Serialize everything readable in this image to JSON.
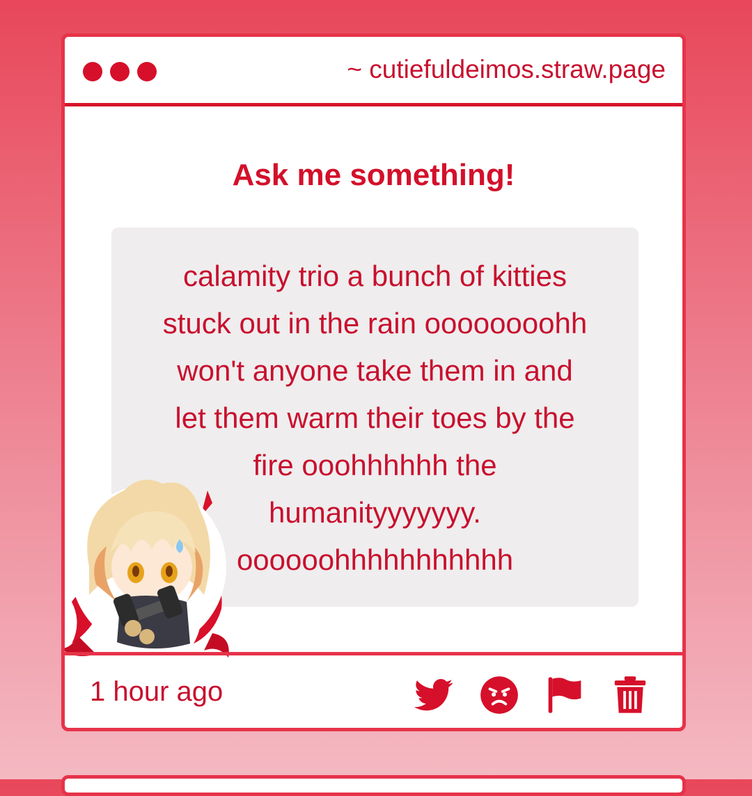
{
  "window": {
    "url": "~ cutiefuldeimos.straw.page"
  },
  "prompt": {
    "heading": "Ask me something!"
  },
  "question": {
    "lines": [
      "calamity trio a bunch of kitties",
      "stuck out in the rain oooooooohh",
      "won't anyone take them in and",
      "let them warm their toes by the",
      "fire ooohhhhhh the",
      "humanityyyyyyy.",
      "oooooohhhhhhhhhhh"
    ]
  },
  "footer": {
    "timestamp": "1 hour ago",
    "actions": [
      {
        "name": "twitter-icon"
      },
      {
        "name": "angry-face-icon"
      },
      {
        "name": "flag-icon"
      },
      {
        "name": "trash-icon"
      }
    ]
  },
  "colors": {
    "accent": "#d3102a",
    "border": "#e6334a",
    "question_bg": "#efedee"
  }
}
